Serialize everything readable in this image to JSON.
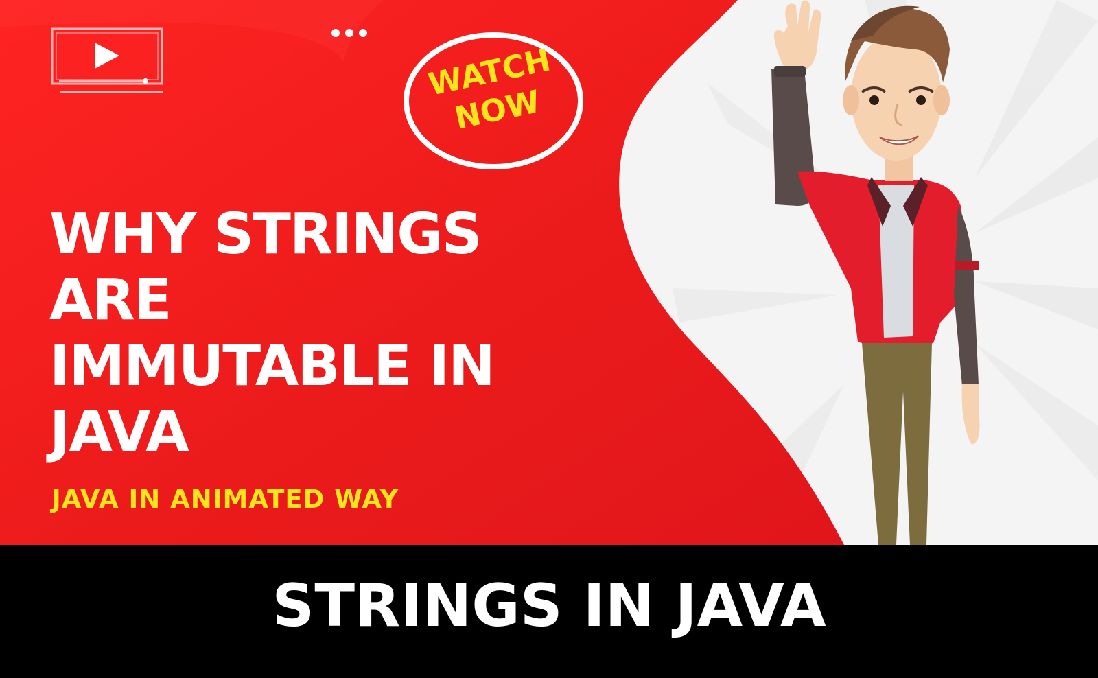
{
  "thumbnail": {
    "badge": {
      "line1": "WATCH",
      "line2": "NOW"
    },
    "headline": {
      "line1": "WHY STRINGS",
      "line2": "ARE",
      "line3": "IMMUTABLE IN",
      "line4": "JAVA"
    },
    "subtitle": "JAVA IN ANIMATED WAY",
    "icons": {
      "play": "play-video-icon",
      "more": "more-dots-icon"
    },
    "colors": {
      "brand_red": "#ef1d1d",
      "accent_yellow": "#ffe41b",
      "text_white": "#ffffff"
    }
  },
  "caption": {
    "text": "STRINGS IN JAVA"
  }
}
